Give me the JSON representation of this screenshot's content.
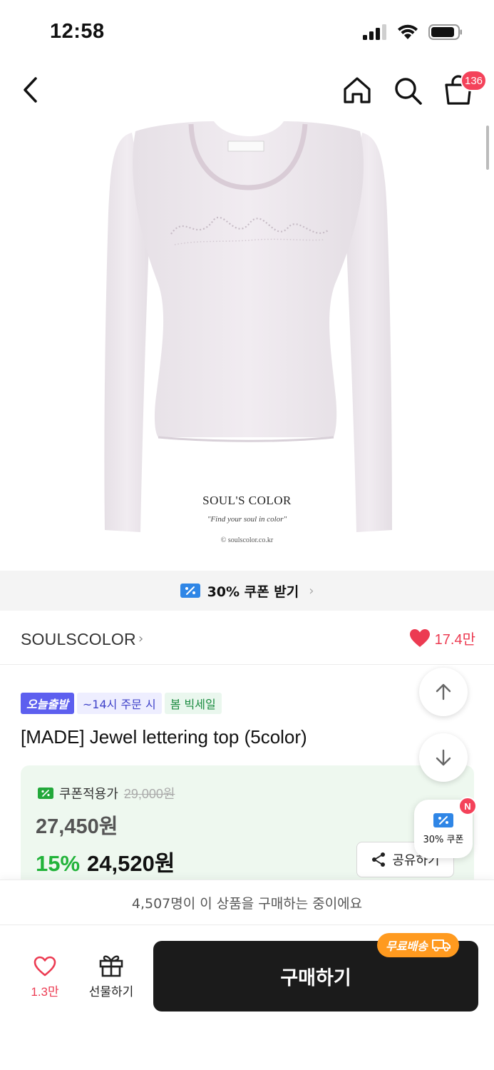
{
  "status_bar": {
    "time": "12:58",
    "icons": [
      "signal-icon",
      "wifi-icon",
      "battery-icon"
    ]
  },
  "nav": {
    "icons": [
      "back-icon",
      "home-icon",
      "search-icon",
      "cart-icon"
    ],
    "cart_badge": "136"
  },
  "product_image": {
    "brand_logo": "SOUL'S COLOR",
    "slogan": "\"Find your soul in color\"",
    "site": "© soulscolor.co.kr"
  },
  "coupon_banner": {
    "label": "30% 쿠폰 받기",
    "icon": "coupon-icon"
  },
  "brand": {
    "name": "SOULSCOLOR",
    "likes": "17.4만"
  },
  "tags": {
    "today": "오늘출발",
    "order": "~14시 주문 시",
    "sale": "봄 빅세일"
  },
  "product": {
    "title": "[MADE] Jewel lettering top (5color)"
  },
  "price": {
    "coupon_label": "쿠폰적용가",
    "original": "29,000원",
    "coupon_price": "27,450원",
    "discount": "15%",
    "sale_price": "24,520원",
    "share_label": "공유하기"
  },
  "floating": {
    "coupon_label": "30% 쿠폰",
    "new_badge": "N"
  },
  "notice": {
    "text": "4,507명이 이 상품을 구매하는 중이에요"
  },
  "bottom_bar": {
    "wish_count": "1.3만",
    "gift_label": "선물하기",
    "buy_label": "구매하기",
    "free_ship": "무료배송"
  },
  "colors": {
    "accent_red": "#ec3b52",
    "discount_green": "#22b33a",
    "price_box_bg": "#eef8ef",
    "buy_button": "#1b1b1b",
    "free_ship_orange": "#ff9a1f",
    "tag_purple": "#5d5fef"
  }
}
